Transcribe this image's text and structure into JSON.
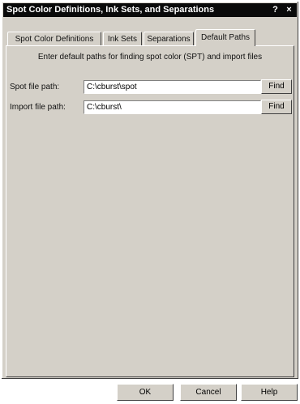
{
  "window": {
    "title": "Spot Color Definitions, Ink Sets, and Separations",
    "help_glyph": "?",
    "close_glyph": "×"
  },
  "tabs": [
    {
      "label": "Spot Color Definitions",
      "active": false
    },
    {
      "label": "Ink Sets",
      "active": false
    },
    {
      "label": "Separations",
      "active": false
    },
    {
      "label": "Default Paths",
      "active": true
    }
  ],
  "default_paths": {
    "instructions": "Enter default paths for finding spot color (SPT) and import files",
    "spot_file": {
      "label": "Spot file path:",
      "value": "C:\\cburst\\spot",
      "button": "Find"
    },
    "import_file": {
      "label": "Import file path:",
      "value": "C:\\cburst\\",
      "button": "Find"
    }
  },
  "footer": {
    "ok": "OK",
    "cancel": "Cancel",
    "help": "Help"
  },
  "colors": {
    "title_bar": "#0a0a0a",
    "face": "#d4d0c8",
    "field_bg": "#ffffff"
  }
}
